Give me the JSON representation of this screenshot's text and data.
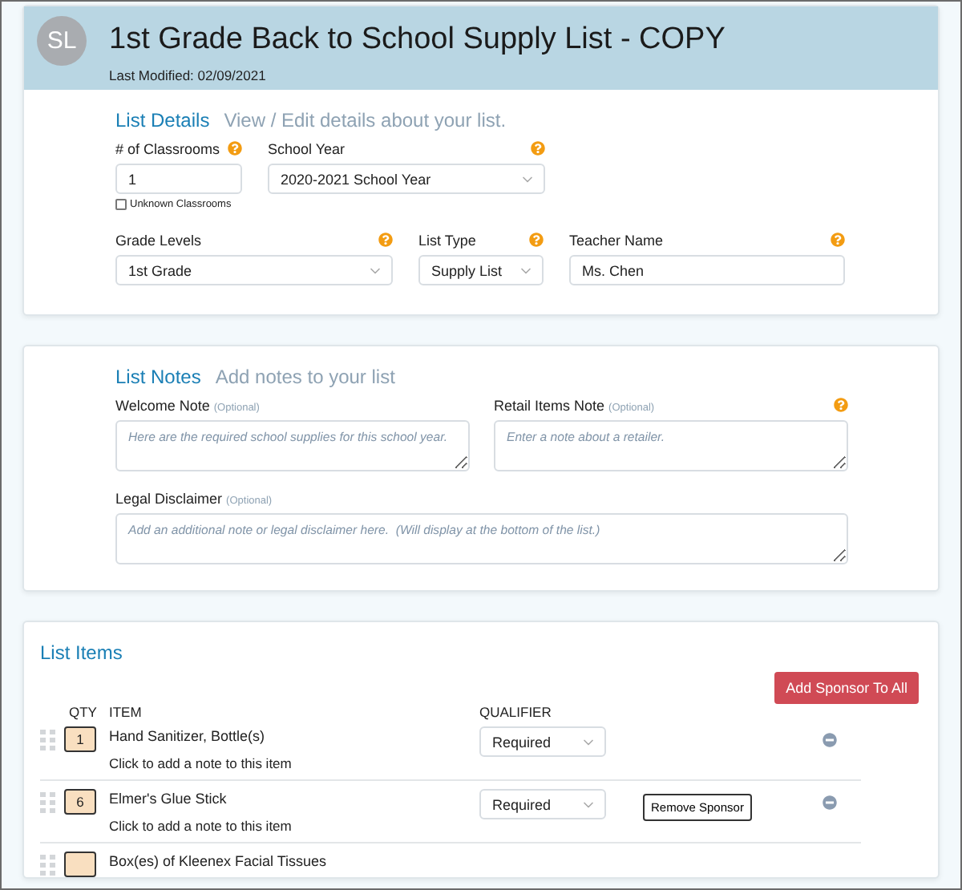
{
  "header": {
    "avatar": "SL",
    "title": "1st Grade Back to School Supply List - COPY",
    "last_modified": "Last Modified: 02/09/2021"
  },
  "details": {
    "heading": "List Details",
    "subheading": "View / Edit details about your list.",
    "rows": [
      [
        {
          "kind": "input",
          "label": "# of Classrooms",
          "help": true,
          "value": "1",
          "checkbox": {
            "label": "Unknown Classrooms",
            "checked": false
          }
        },
        {
          "kind": "select",
          "label": "School Year",
          "help": true,
          "value": "2020-2021 School Year"
        }
      ],
      [
        {
          "kind": "select",
          "label": "Grade Levels",
          "help": true,
          "value": "1st Grade"
        },
        {
          "kind": "select",
          "label": "List Type",
          "help": true,
          "value": "Supply List"
        },
        {
          "kind": "input",
          "label": "Teacher Name",
          "help": true,
          "value": "Ms. Chen"
        }
      ]
    ]
  },
  "notes": {
    "heading": "List Notes",
    "subheading": "Add notes to your list",
    "fields": [
      {
        "label": "Welcome Note",
        "optional": "(Optional)",
        "help": false,
        "placeholder": "Here are the required school supplies for this school year."
      },
      {
        "label": "Retail Items Note",
        "optional": "(Optional)",
        "help": true,
        "placeholder": "Enter a note about a retailer."
      },
      {
        "label": "Legal Disclaimer",
        "optional": "(Optional)",
        "help": false,
        "placeholder": "Add an additional note or legal disclaimer here.  (Will display at the bottom of the list.)"
      }
    ]
  },
  "items": {
    "heading": "List Items",
    "add_sponsor_button": "Add Sponsor To All",
    "columns": [
      "QTY",
      "ITEM",
      "QUALIFIER"
    ],
    "rows": [
      {
        "qty": "1",
        "name": "Hand Sanitizer, Bottle(s)",
        "note": "Click to add a note to this item",
        "qualifier": "Required"
      },
      {
        "qty": "6",
        "name": "Elmer's Glue Stick",
        "note": "Click to add a note to this item",
        "qualifier": "Required",
        "sponsor_button": "Remove Sponsor"
      },
      {
        "name": "Box(es) of Kleenex Facial Tissues"
      }
    ]
  }
}
